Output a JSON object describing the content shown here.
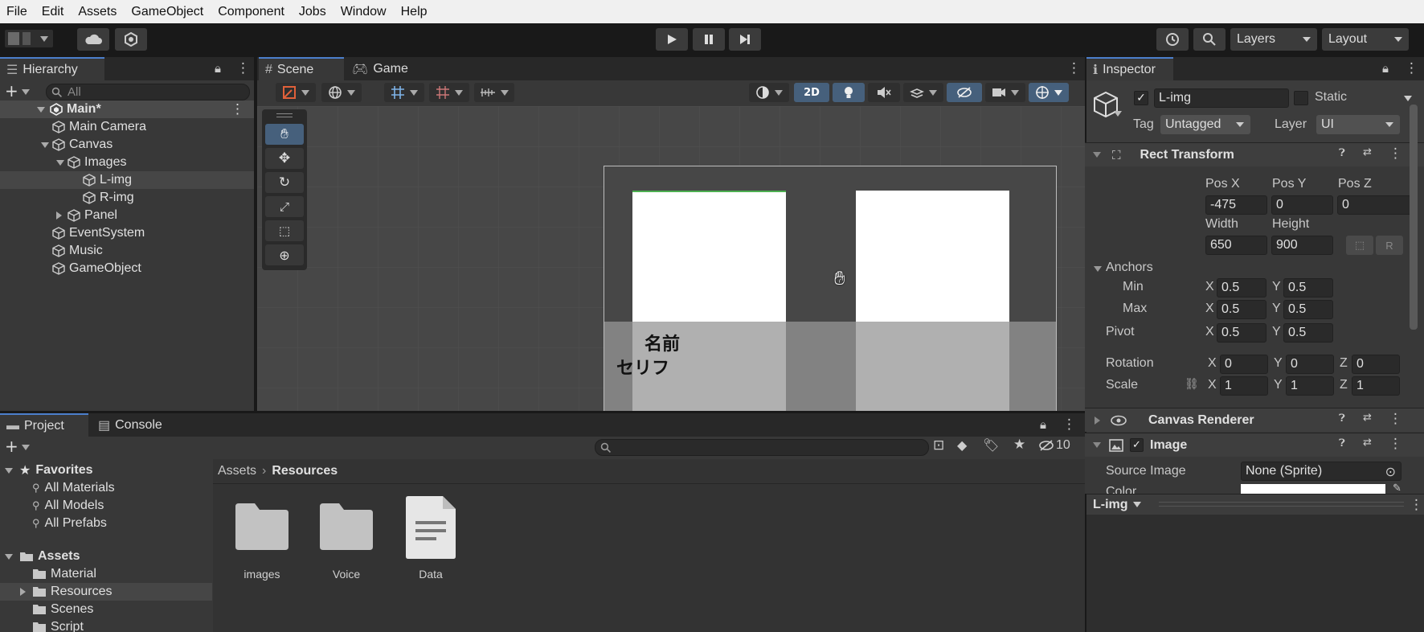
{
  "menu": [
    "File",
    "Edit",
    "Assets",
    "GameObject",
    "Component",
    "Jobs",
    "Window",
    "Help"
  ],
  "toolbar": {
    "layers_label": "Layers",
    "layout_label": "Layout"
  },
  "hierarchy": {
    "tab_label": "Hierarchy",
    "search_placeholder": "All",
    "scene_name": "Main*",
    "items": [
      {
        "label": "Main Camera",
        "indent": 1
      },
      {
        "label": "Canvas",
        "indent": 1
      },
      {
        "label": "Images",
        "indent": 2
      },
      {
        "label": "L-img",
        "indent": 3
      },
      {
        "label": "R-img",
        "indent": 3
      },
      {
        "label": "Panel",
        "indent": 2
      },
      {
        "label": "EventSystem",
        "indent": 1
      },
      {
        "label": "Music",
        "indent": 1
      },
      {
        "label": "GameObject",
        "indent": 1
      }
    ]
  },
  "scene_view": {
    "tab_scene": "Scene",
    "tab_game": "Game",
    "btn_2d": "2D",
    "canvas_text_name": "名前",
    "canvas_text_line": "セリフ"
  },
  "project": {
    "tab_project": "Project",
    "tab_console": "Console",
    "hidden_count": "10",
    "breadcrumb_root": "Assets",
    "breadcrumb_current": "Resources",
    "favorites_label": "Favorites",
    "favorites": [
      "All Materials",
      "All Models",
      "All Prefabs"
    ],
    "assets_label": "Assets",
    "assets_children": [
      "Material",
      "Resources",
      "Scenes",
      "Script"
    ],
    "files": [
      {
        "name": "images",
        "type": "folder"
      },
      {
        "name": "Voice",
        "type": "folder"
      },
      {
        "name": "Data",
        "type": "file"
      }
    ]
  },
  "inspector": {
    "tab_label": "Inspector",
    "object_name": "L-img",
    "static_label": "Static",
    "tag_label": "Tag",
    "tag_value": "Untagged",
    "layer_label": "Layer",
    "layer_value": "UI",
    "rect_transform_label": "Rect Transform",
    "pos_x_label": "Pos X",
    "pos_y_label": "Pos Y",
    "pos_z_label": "Pos Z",
    "pos_x": "-475",
    "pos_y": "0",
    "pos_z": "0",
    "width_label": "Width",
    "height_label": "Height",
    "width": "650",
    "height": "900",
    "r_button": "R",
    "anchors_label": "Anchors",
    "min_label": "Min",
    "max_label": "Max",
    "pivot_label": "Pivot",
    "anchor_min_x": "0.5",
    "anchor_min_y": "0.5",
    "anchor_max_x": "0.5",
    "anchor_max_y": "0.5",
    "pivot_x": "0.5",
    "pivot_y": "0.5",
    "rotation_label": "Rotation",
    "rot_x": "0",
    "rot_y": "0",
    "rot_z": "0",
    "scale_label": "Scale",
    "scale_x": "1",
    "scale_y": "1",
    "scale_z": "1",
    "axis_x": "X",
    "axis_y": "Y",
    "axis_z": "Z",
    "canvas_renderer_label": "Canvas Renderer",
    "image_label": "Image",
    "source_image_label": "Source Image",
    "source_image_value": "None (Sprite)",
    "color_label": "Color",
    "preview_label": "L-img"
  }
}
